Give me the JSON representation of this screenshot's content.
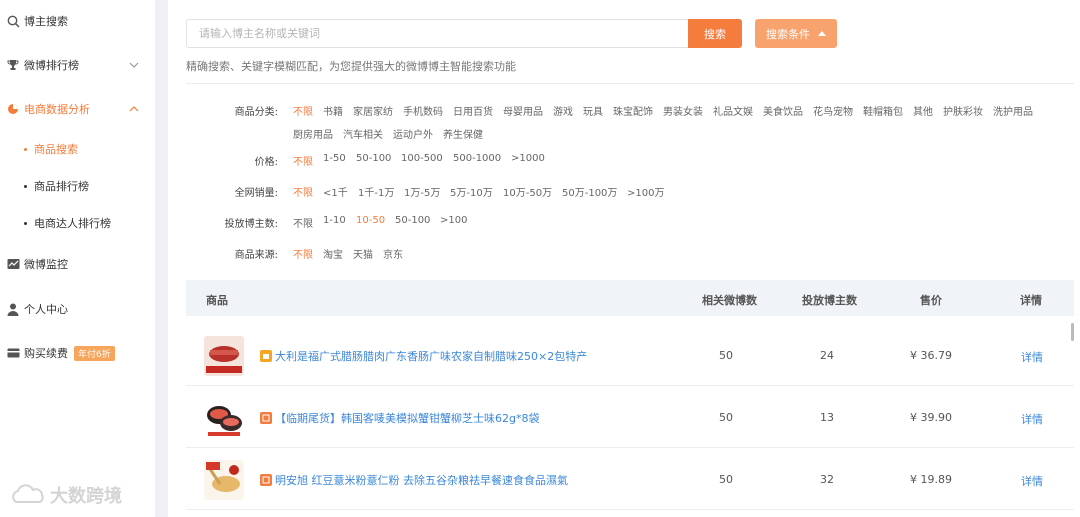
{
  "sidebar": {
    "items": [
      {
        "label": "博主搜索",
        "icon": "search-icon"
      },
      {
        "label": "微博排行榜",
        "icon": "trophy-icon"
      },
      {
        "label": "电商数据分析",
        "icon": "pie-chart-icon"
      },
      {
        "label": "微博监控",
        "icon": "monitor-chart-icon"
      },
      {
        "label": "个人中心",
        "icon": "user-icon"
      },
      {
        "label": "购买续费",
        "icon": "card-icon",
        "badge": "年付6折"
      }
    ],
    "subitems": [
      {
        "label": "商品搜索"
      },
      {
        "label": "商品排行榜"
      },
      {
        "label": "电商达人排行榜"
      }
    ],
    "watermark": "大数跨境"
  },
  "search": {
    "placeholder": "请输入博主名称或关键词",
    "button": "搜索",
    "condition_button": "搜索条件",
    "hint": "精确搜索、关键字模糊匹配，为您提供强大的微博博主智能搜索功能"
  },
  "filters": {
    "category": {
      "label": "商品分类:",
      "options": [
        "不限",
        "书籍",
        "家居家纺",
        "手机数码",
        "日用百货",
        "母婴用品",
        "游戏",
        "玩具",
        "珠宝配饰",
        "男装女装",
        "礼品文娱",
        "美食饮品",
        "花鸟宠物",
        "鞋帽箱包",
        "其他",
        "护肤彩妆",
        "洗护用品",
        "厨房用品",
        "汽车相关",
        "运动户外",
        "养生保健"
      ],
      "selected": 0
    },
    "price": {
      "label": "价格:",
      "options": [
        "不限",
        "1-50",
        "50-100",
        "100-500",
        "500-1000",
        ">1000"
      ],
      "selected": 0
    },
    "sales": {
      "label": "全网销量:",
      "options": [
        "不限",
        "<1千",
        "1千-1万",
        "1万-5万",
        "5万-10万",
        "10万-50万",
        "50万-100万",
        ">100万"
      ],
      "selected": 0
    },
    "bloggers": {
      "label": "投放博主数:",
      "options": [
        "不限",
        "1-10",
        "10-50",
        "50-100",
        ">100"
      ],
      "selected": 2
    },
    "source": {
      "label": "商品来源:",
      "options": [
        "不限",
        "淘宝",
        "天猫",
        "京东"
      ],
      "selected": 0
    }
  },
  "table": {
    "headers": {
      "product": "商品",
      "weibo_count": "相关微博数",
      "blogger_count": "投放博主数",
      "price": "售价",
      "detail": "详情"
    },
    "rows": [
      {
        "name": "大利是福广式腊肠腊肉广东香肠广味农家自制腊味250×2包特产",
        "weibo_count": "50",
        "blogger_count": "24",
        "price": "¥ 36.79",
        "detail": "详情",
        "shop_color": "#f5a623"
      },
      {
        "name": "【临期尾货】韩国客唛美模拟蟹钳蟹柳芝士味62g*8袋",
        "weibo_count": "50",
        "blogger_count": "13",
        "price": "¥ 39.90",
        "detail": "详情",
        "shop_color": "#f47c3c"
      },
      {
        "name": "明安旭 红豆薏米粉薏仁粉 去除五谷杂粮祛早餐速食食品濕氣",
        "weibo_count": "50",
        "blogger_count": "32",
        "price": "¥ 19.89",
        "detail": "详情",
        "shop_color": "#f47c3c"
      }
    ]
  },
  "colors": {
    "accent": "#f47c3c",
    "accent_light": "#f8a26d",
    "link": "#3a87d8"
  }
}
